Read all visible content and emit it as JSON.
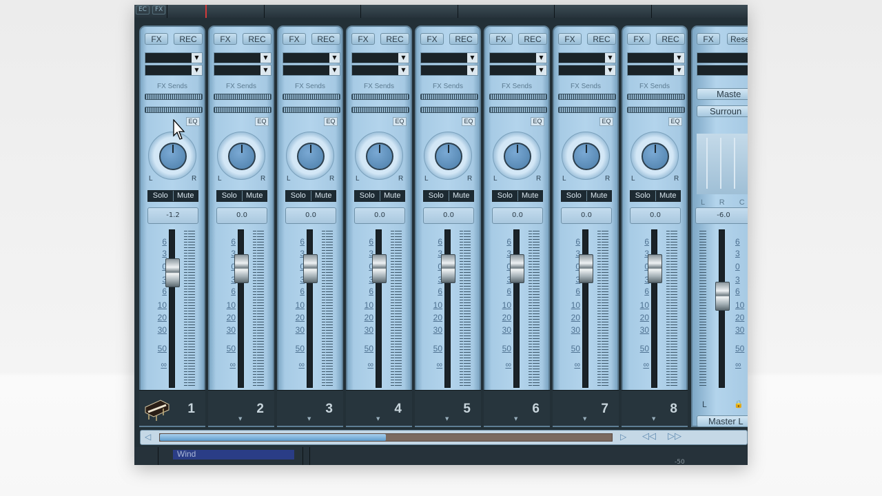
{
  "top_bar": {
    "buttons": [
      "EC",
      "FX"
    ]
  },
  "channels": [
    {
      "number": "1",
      "fx": "FX",
      "rec": "REC",
      "sends": "FX Sends",
      "eq": "EQ",
      "solo": "Solo",
      "mute": "Mute",
      "volume": "-1.2",
      "pan_left": "L",
      "pan_right": "R",
      "has_instrument_icon": true,
      "fader_db": -1.2
    },
    {
      "number": "2",
      "fx": "FX",
      "rec": "REC",
      "sends": "FX Sends",
      "eq": "EQ",
      "solo": "Solo",
      "mute": "Mute",
      "volume": "0.0",
      "pan_left": "L",
      "pan_right": "R",
      "fader_db": 0.0
    },
    {
      "number": "3",
      "fx": "FX",
      "rec": "REC",
      "sends": "FX Sends",
      "eq": "EQ",
      "solo": "Solo",
      "mute": "Mute",
      "volume": "0.0",
      "pan_left": "L",
      "pan_right": "R",
      "fader_db": 0.0
    },
    {
      "number": "4",
      "fx": "FX",
      "rec": "REC",
      "sends": "FX Sends",
      "eq": "EQ",
      "solo": "Solo",
      "mute": "Mute",
      "volume": "0.0",
      "pan_left": "L",
      "pan_right": "R",
      "fader_db": 0.0
    },
    {
      "number": "5",
      "fx": "FX",
      "rec": "REC",
      "sends": "FX Sends",
      "eq": "EQ",
      "solo": "Solo",
      "mute": "Mute",
      "volume": "0.0",
      "pan_left": "L",
      "pan_right": "R",
      "fader_db": 0.0
    },
    {
      "number": "6",
      "fx": "FX",
      "rec": "REC",
      "sends": "FX Sends",
      "eq": "EQ",
      "solo": "Solo",
      "mute": "Mute",
      "volume": "0.0",
      "pan_left": "L",
      "pan_right": "R",
      "fader_db": 0.0
    },
    {
      "number": "7",
      "fx": "FX",
      "rec": "REC",
      "sends": "FX Sends",
      "eq": "EQ",
      "solo": "Solo",
      "mute": "Mute",
      "volume": "0.0",
      "pan_left": "L",
      "pan_right": "R",
      "fader_db": 0.0
    },
    {
      "number": "8",
      "fx": "FX",
      "rec": "REC",
      "sends": "FX Sends",
      "eq": "EQ",
      "solo": "Solo",
      "mute": "Mute",
      "volume": "0.0",
      "pan_left": "L",
      "pan_right": "R",
      "fader_db": 0.0
    }
  ],
  "fader_scale": [
    "6",
    "3",
    "0",
    "3",
    "6",
    "10",
    "20",
    "30",
    "50",
    "∞"
  ],
  "master": {
    "fx": "FX",
    "reset": "Rese",
    "master_label": "Maste",
    "surround_label": "Surroun",
    "meter_channels": "L R C L",
    "volume": "-6.0",
    "left_label": "L",
    "master_link": "Master L",
    "scale_right": [
      "6",
      "3",
      "0",
      "3",
      "6",
      "10",
      "20",
      "30",
      "50",
      "∞"
    ],
    "fader_db": -6.0
  },
  "scrollbar": {
    "thumb_fraction": 0.5
  },
  "bottom": {
    "track_name": "Wind",
    "db_readout": "-50"
  },
  "colors": {
    "strip": "#b3d4ec",
    "dark": "#233037",
    "accent_blue": "#5e9ccc"
  }
}
